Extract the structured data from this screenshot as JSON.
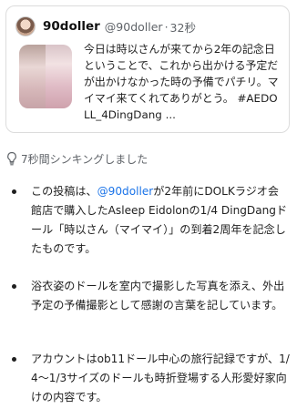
{
  "tweet": {
    "display_name": "90doller",
    "handle": "@90doller",
    "separator": "·",
    "time": "32秒",
    "text": "今日は時以さんが来てから2年の記念日ということで、これから出かける予定だが出かけなかった時の予備でパチリ。マイマイ来てくれてありがとう。 #AEDOLL_4DingDang ..."
  },
  "thinking": {
    "icon": "lightbulb-icon",
    "label": "7秒間シンキングしました"
  },
  "bullets": [
    {
      "pre": "この投稿は、",
      "link": "@90doller",
      "post": "が2年前にDOLKラジオ会館店で購入したAsleep Eidolonの1/4 DingDangドール「時以さん（マイマイ）」の到着2周年を記念したものです。"
    },
    {
      "text": "浴衣姿のドールを室内で撮影した写真を添え、外出予定の予備撮影として感謝の言葉を記しています。"
    },
    {
      "text": "アカウントはob11ドール中心の旅行記録ですが、1/4〜1/3サイズのドールも時折登場する人形愛好家向けの内容です。"
    }
  ],
  "colors": {
    "link": "#1a73e8",
    "muted": "#5f6368",
    "border": "#dcdcdc"
  }
}
